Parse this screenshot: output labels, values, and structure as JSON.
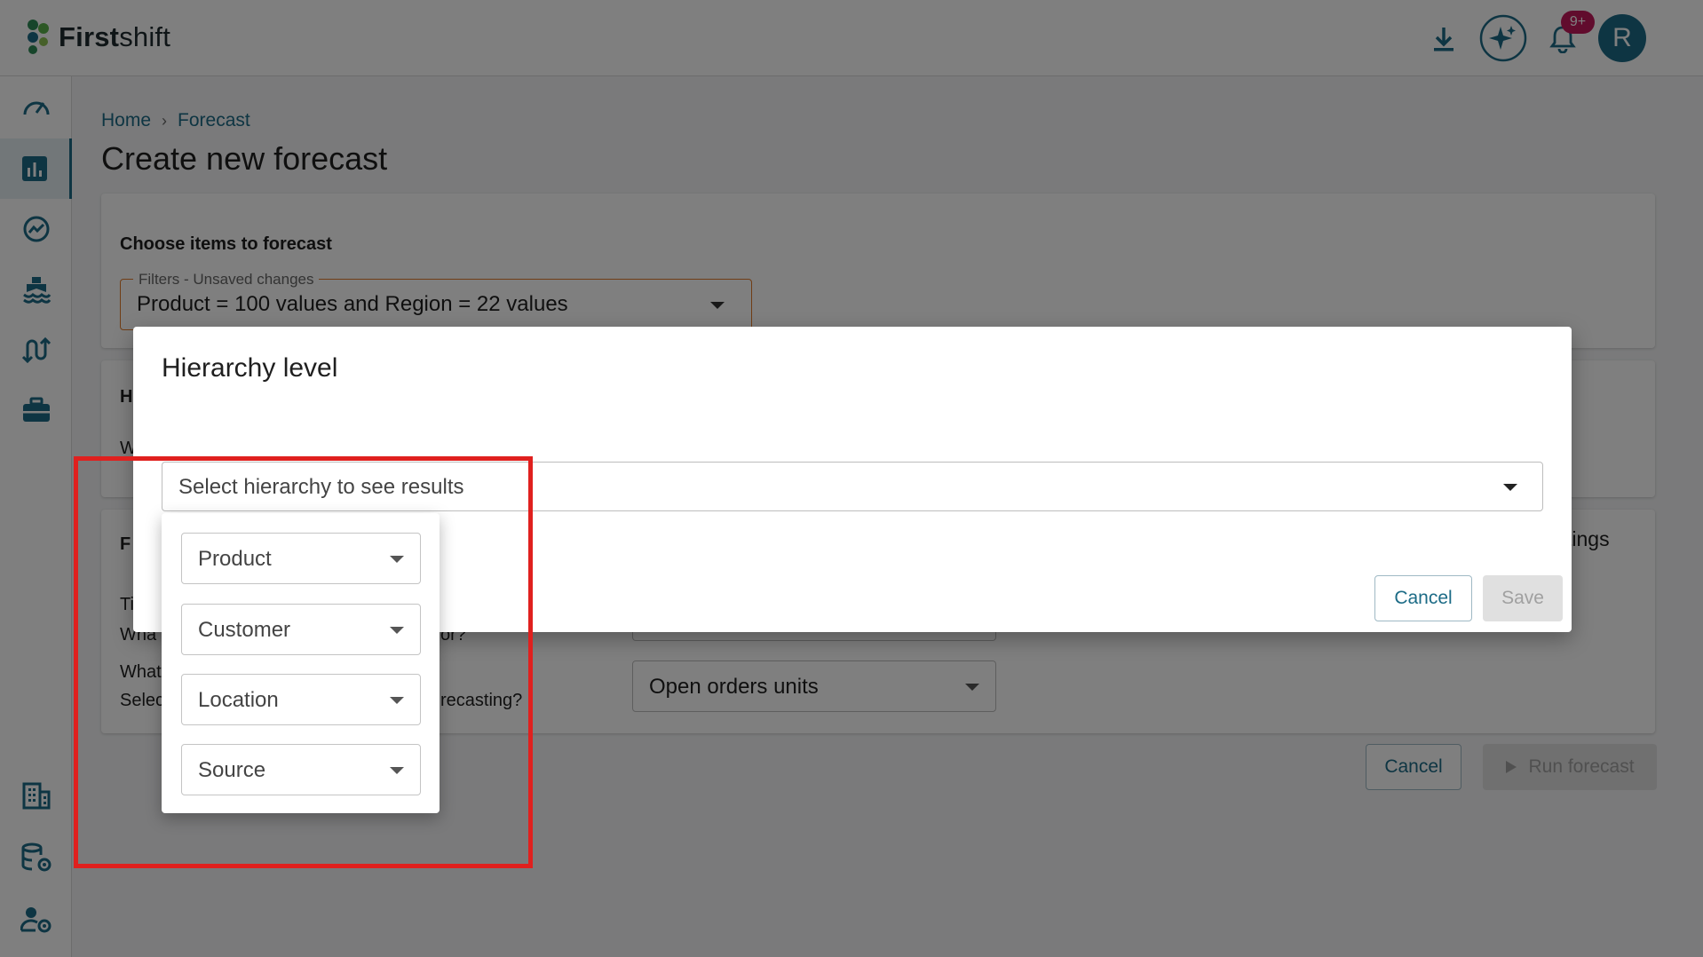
{
  "app": {
    "logo_bold": "First",
    "logo_rest": "shift"
  },
  "topbar": {
    "notification_count": "9+",
    "avatar_initial": "R"
  },
  "breadcrumb": {
    "home": "Home",
    "separator": "›",
    "current": "Forecast"
  },
  "page": {
    "title": "Create new forecast"
  },
  "choose_card": {
    "title": "Choose items to forecast",
    "filter_label": "Filters - Unsaved changes",
    "filter_value": "Product = 100 values and Region = 22 values"
  },
  "hierarchy_card": {
    "title_fragment": "H",
    "text_fragment": "W"
  },
  "forecast_card": {
    "title_fragment": "F",
    "settings_fragment": "tings",
    "row1_line1_fragment": "Ti",
    "row1_line2_start": "Wha",
    "row1_line2_end": "or?",
    "row2_line1_fragment": "What",
    "row2_line2_start": "Selec",
    "row2_line2_end": "recasting?",
    "measure_value": "Open orders units"
  },
  "page_actions": {
    "cancel": "Cancel",
    "run": "Run forecast"
  },
  "dialog": {
    "title": "Hierarchy level",
    "select_placeholder": "Select hierarchy to see results",
    "cancel": "Cancel",
    "save": "Save"
  },
  "hierarchy_menu": {
    "items": [
      "Product",
      "Customer",
      "Location",
      "Source"
    ]
  },
  "colors": {
    "brand": "#1c6b86",
    "highlight": "#e0201e",
    "badge": "#c2185b",
    "filter_border": "#e07b2a"
  }
}
